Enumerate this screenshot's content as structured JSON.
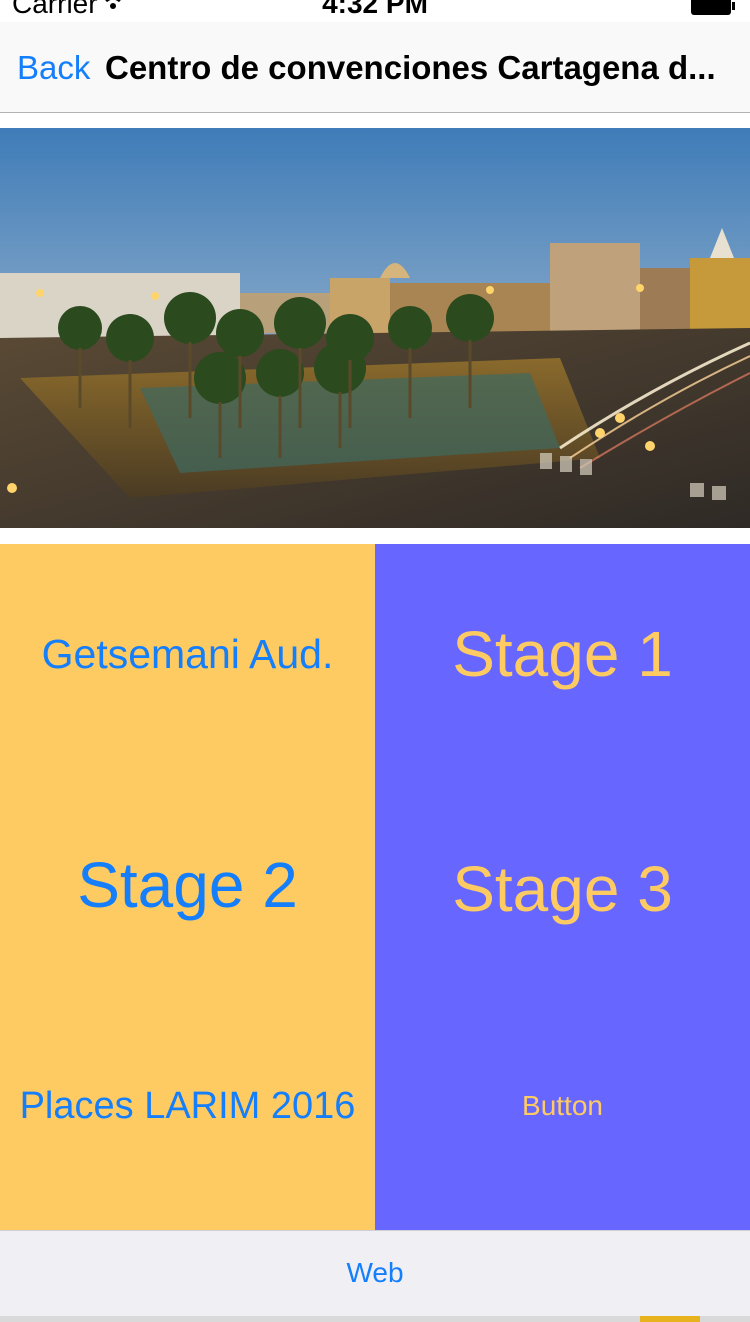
{
  "status_bar": {
    "carrier": "Carrier",
    "time": "4:32 PM"
  },
  "nav": {
    "back_label": "Back",
    "title": "Centro de convenciones Cartagena d..."
  },
  "grid": {
    "getsemani_label": "Getsemani Aud.",
    "stage1_label": "Stage 1",
    "stage2_label": "Stage 2",
    "stage3_label": "Stage 3",
    "places_label": "Places LARIM 2016",
    "button_label": "Button"
  },
  "tab_bar": {
    "web_label": "Web"
  },
  "colors": {
    "accent_blue": "#147efb",
    "left_column_yellow": "#fecb63",
    "right_column_purple": "#6766fe"
  }
}
